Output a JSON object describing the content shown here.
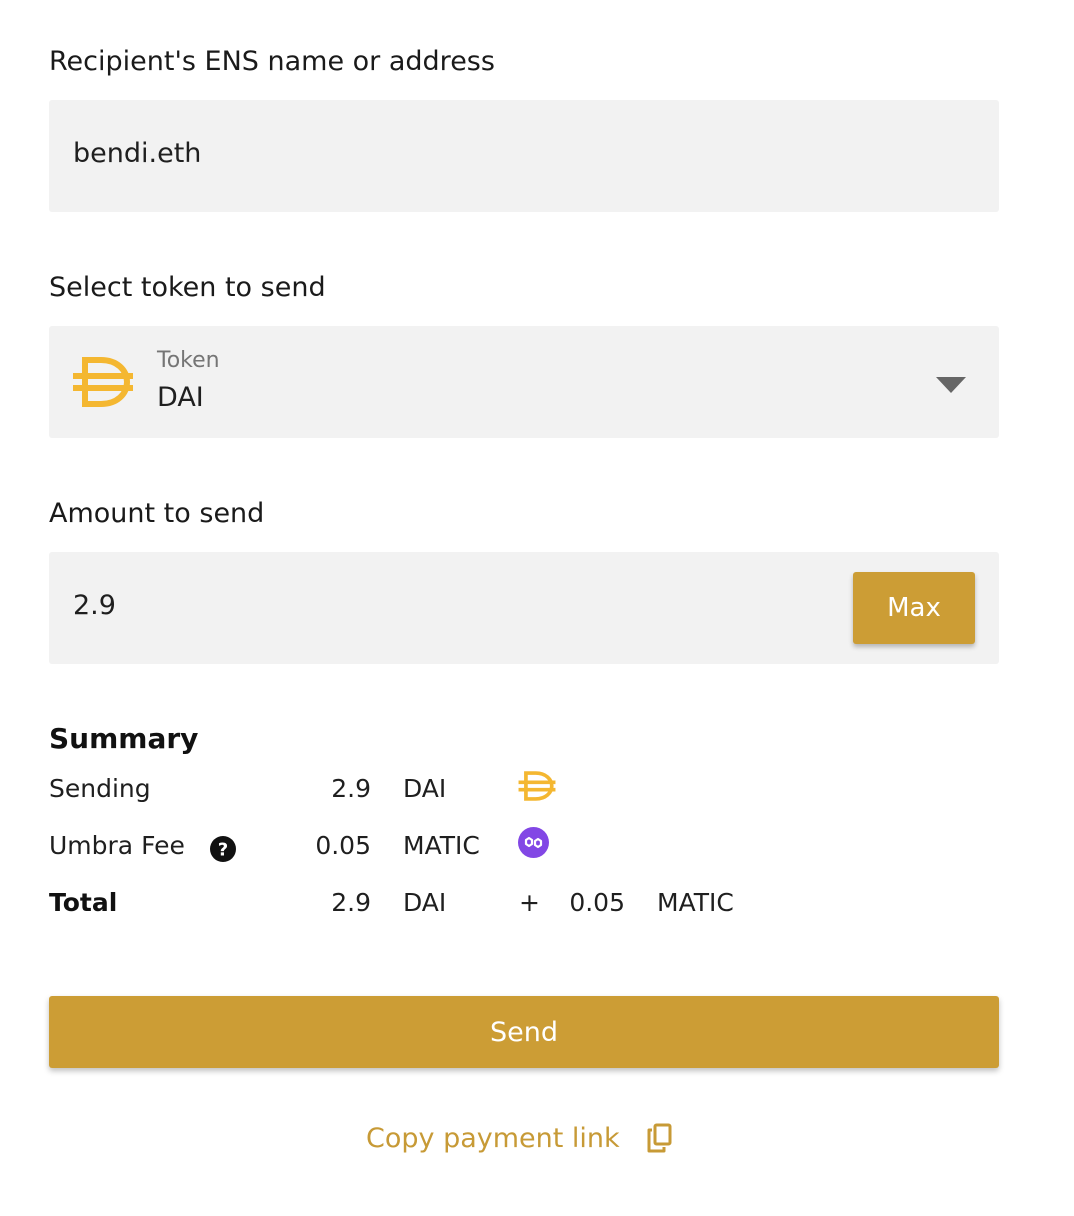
{
  "recipient": {
    "label": "Recipient's ENS name or address",
    "value": "bendi.eth"
  },
  "token": {
    "label": "Select token to send",
    "caption": "Token",
    "value": "DAI",
    "icon": "dai-icon",
    "dropdown_icon": "caret-down-icon"
  },
  "amount": {
    "label": "Amount to send",
    "value": "2.9",
    "max_label": "Max"
  },
  "summary": {
    "title": "Summary",
    "sending": {
      "label": "Sending",
      "amount": "2.9",
      "unit": "DAI",
      "icon": "dai-icon"
    },
    "fee": {
      "label": "Umbra Fee",
      "amount": "0.05",
      "unit": "MATIC",
      "icon": "matic-icon",
      "help_icon": "question-circle-icon"
    },
    "total": {
      "label": "Total",
      "amount": "2.9",
      "unit": "DAI",
      "plus": "+",
      "amount2": "0.05",
      "unit2": "MATIC"
    }
  },
  "send_label": "Send",
  "copy_link": {
    "label": "Copy payment link",
    "icon": "copy-icon"
  },
  "colors": {
    "accent": "#cc9d35",
    "dai": "#f4b731",
    "matic": "#8247e5",
    "field_bg": "#f2f2f2"
  }
}
